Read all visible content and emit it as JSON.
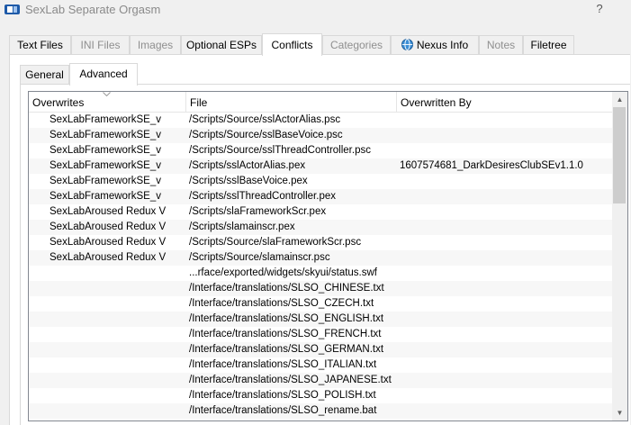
{
  "window": {
    "title": "SexLab Separate Orgasm",
    "help_label": "?"
  },
  "main_tabs": [
    {
      "label": "Text Files",
      "state": "normal"
    },
    {
      "label": "INI Files",
      "state": "disabled"
    },
    {
      "label": "Images",
      "state": "disabled"
    },
    {
      "label": "Optional ESPs",
      "state": "normal"
    },
    {
      "label": "Conflicts",
      "state": "active"
    },
    {
      "label": "Categories",
      "state": "disabled"
    },
    {
      "label": "Nexus Info",
      "state": "normal",
      "icon": "nexus-globe-icon"
    },
    {
      "label": "Notes",
      "state": "disabled"
    },
    {
      "label": "Filetree",
      "state": "normal"
    }
  ],
  "sub_tabs": [
    {
      "label": "General",
      "state": "normal"
    },
    {
      "label": "Advanced",
      "state": "active"
    }
  ],
  "table": {
    "columns": [
      "Overwrites",
      "File",
      "Overwritten By"
    ],
    "sorted_column": "Overwrites",
    "rows": [
      {
        "overwrites": "SexLabFrameworkSE_v",
        "file": "/Scripts/Source/sslActorAlias.psc",
        "overwritten_by": ""
      },
      {
        "overwrites": "SexLabFrameworkSE_v",
        "file": "/Scripts/Source/sslBaseVoice.psc",
        "overwritten_by": ""
      },
      {
        "overwrites": "SexLabFrameworkSE_v",
        "file": "/Scripts/Source/sslThreadController.psc",
        "overwritten_by": ""
      },
      {
        "overwrites": "SexLabFrameworkSE_v",
        "file": "/Scripts/sslActorAlias.pex",
        "overwritten_by": "1607574681_DarkDesiresClubSEv1.1.0"
      },
      {
        "overwrites": "SexLabFrameworkSE_v",
        "file": "/Scripts/sslBaseVoice.pex",
        "overwritten_by": ""
      },
      {
        "overwrites": "SexLabFrameworkSE_v",
        "file": "/Scripts/sslThreadController.pex",
        "overwritten_by": ""
      },
      {
        "overwrites": "SexLabAroused Redux V",
        "file": "/Scripts/slaFrameworkScr.pex",
        "overwritten_by": ""
      },
      {
        "overwrites": "SexLabAroused Redux V",
        "file": "/Scripts/slamainscr.pex",
        "overwritten_by": ""
      },
      {
        "overwrites": "SexLabAroused Redux V",
        "file": "/Scripts/Source/slaFrameworkScr.psc",
        "overwritten_by": ""
      },
      {
        "overwrites": "SexLabAroused Redux V",
        "file": "/Scripts/Source/slamainscr.psc",
        "overwritten_by": ""
      },
      {
        "overwrites": "",
        "file": "...rface/exported/widgets/skyui/status.swf",
        "overwritten_by": ""
      },
      {
        "overwrites": "",
        "file": "/Interface/translations/SLSO_CHINESE.txt",
        "overwritten_by": ""
      },
      {
        "overwrites": "",
        "file": "/Interface/translations/SLSO_CZECH.txt",
        "overwritten_by": ""
      },
      {
        "overwrites": "",
        "file": "/Interface/translations/SLSO_ENGLISH.txt",
        "overwritten_by": ""
      },
      {
        "overwrites": "",
        "file": "/Interface/translations/SLSO_FRENCH.txt",
        "overwritten_by": ""
      },
      {
        "overwrites": "",
        "file": "/Interface/translations/SLSO_GERMAN.txt",
        "overwritten_by": ""
      },
      {
        "overwrites": "",
        "file": "/Interface/translations/SLSO_ITALIAN.txt",
        "overwritten_by": ""
      },
      {
        "overwrites": "",
        "file": "/Interface/translations/SLSO_JAPANESE.txt",
        "overwritten_by": ""
      },
      {
        "overwrites": "",
        "file": "/Interface/translations/SLSO_POLISH.txt",
        "overwritten_by": ""
      },
      {
        "overwrites": "",
        "file": "/Interface/translations/SLSO_rename.bat",
        "overwritten_by": ""
      }
    ]
  },
  "scrollbar": {
    "up_icon": "scroll-up-arrow-icon",
    "down_icon": "scroll-down-arrow-icon"
  },
  "colors": {
    "disabled_text": "#8f8f8f",
    "title_text": "#8a8a8a",
    "nexus_icon": "#3d8fd6"
  }
}
